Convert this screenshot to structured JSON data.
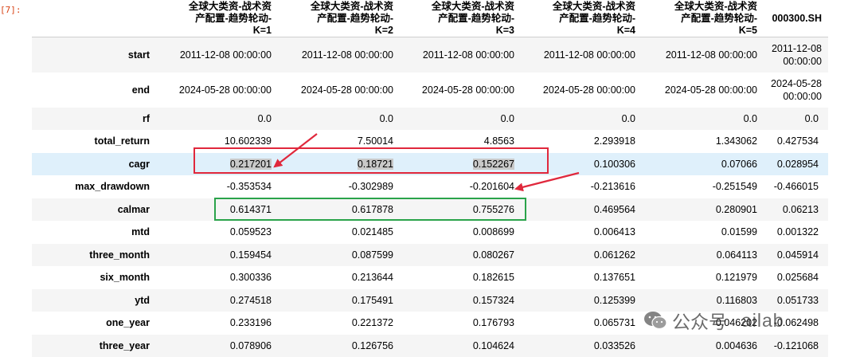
{
  "cell_prompt": "[7]:",
  "columns": [
    "全球大类资-战术资产配置-趋势轮动-K=1",
    "全球大类资-战术资产配置-趋势轮动-K=2",
    "全球大类资-战术资产配置-趋势轮动-K=3",
    "全球大类资-战术资产配置-趋势轮动-K=4",
    "全球大类资-战术资产配置-趋势轮动-K=5",
    "000300.SH"
  ],
  "rows": [
    {
      "label": "start",
      "values": [
        "2011-12-08 00:00:00",
        "2011-12-08 00:00:00",
        "2011-12-08 00:00:00",
        "2011-12-08 00:00:00",
        "2011-12-08 00:00:00",
        "2011-12-08 00:00:00"
      ]
    },
    {
      "label": "end",
      "values": [
        "2024-05-28 00:00:00",
        "2024-05-28 00:00:00",
        "2024-05-28 00:00:00",
        "2024-05-28 00:00:00",
        "2024-05-28 00:00:00",
        "2024-05-28 00:00:00"
      ]
    },
    {
      "label": "rf",
      "values": [
        "0.0",
        "0.0",
        "0.0",
        "0.0",
        "0.0",
        "0.0"
      ]
    },
    {
      "label": "total_return",
      "values": [
        "10.602339",
        "7.50014",
        "4.8563",
        "2.293918",
        "1.343062",
        "0.427534"
      ]
    },
    {
      "label": "cagr",
      "values": [
        "0.217201",
        "0.18721",
        "0.152267",
        "0.100306",
        "0.07066",
        "0.028954"
      ]
    },
    {
      "label": "max_drawdown",
      "values": [
        "-0.353534",
        "-0.302989",
        "-0.201604",
        "-0.213616",
        "-0.251549",
        "-0.466015"
      ]
    },
    {
      "label": "calmar",
      "values": [
        "0.614371",
        "0.617878",
        "0.755276",
        "0.469564",
        "0.280901",
        "0.06213"
      ]
    },
    {
      "label": "mtd",
      "values": [
        "0.059523",
        "0.021485",
        "0.008699",
        "0.006413",
        "0.01599",
        "0.001322"
      ]
    },
    {
      "label": "three_month",
      "values": [
        "0.159454",
        "0.087599",
        "0.080267",
        "0.061262",
        "0.064113",
        "0.045914"
      ]
    },
    {
      "label": "six_month",
      "values": [
        "0.300336",
        "0.213644",
        "0.182615",
        "0.137651",
        "0.121979",
        "0.025684"
      ]
    },
    {
      "label": "ytd",
      "values": [
        "0.274518",
        "0.175491",
        "0.157324",
        "0.125399",
        "0.116803",
        "0.051733"
      ]
    },
    {
      "label": "one_year",
      "values": [
        "0.233196",
        "0.221372",
        "0.176793",
        "0.065731",
        "0.046202",
        "-0.062498"
      ]
    },
    {
      "label": "three_year",
      "values": [
        "0.078906",
        "0.126756",
        "0.104624",
        "0.033526",
        "0.004636",
        "-0.121068"
      ]
    }
  ],
  "watermark": {
    "icon": "wechat-icon",
    "label": "公众号",
    "handle": "ailab"
  },
  "annotation_colors": {
    "red": "#e0283c",
    "green": "#2aa34a",
    "hover_row": "#dff0fb"
  }
}
